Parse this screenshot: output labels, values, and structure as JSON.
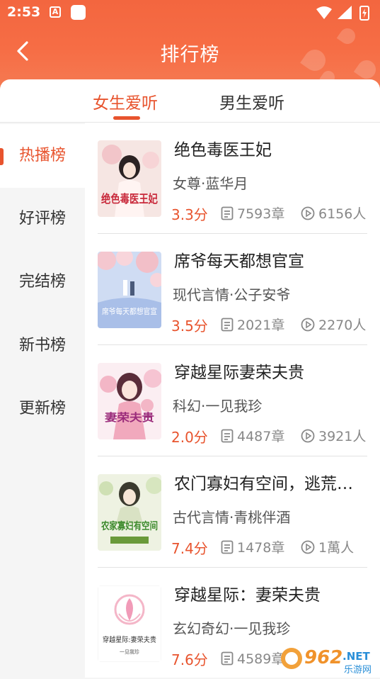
{
  "status_bar": {
    "time": "2:53",
    "a_icon_letter": "A"
  },
  "header": {
    "title": "排行榜",
    "accent_color": "#f3663f"
  },
  "tabs": [
    {
      "label": "女生爱听",
      "active": true
    },
    {
      "label": "男生爱听",
      "active": false
    }
  ],
  "sidebar": {
    "items": [
      {
        "label": "热播榜",
        "active": true
      },
      {
        "label": "好评榜",
        "active": false
      },
      {
        "label": "完结榜",
        "active": false
      },
      {
        "label": "新书榜",
        "active": false
      },
      {
        "label": "更新榜",
        "active": false
      }
    ]
  },
  "books": [
    {
      "title": "绝色毒医王妃",
      "author": "女尊·蓝华月",
      "score": "3.3分",
      "chapters": "7593章",
      "listeners": "6156人",
      "cover_text": "绝色毒医王妃"
    },
    {
      "title": "席爷每天都想官宣",
      "author": "现代言情·公子安爷",
      "score": "3.5分",
      "chapters": "2021章",
      "listeners": "2270人",
      "cover_text": "席爷每天都想官宣"
    },
    {
      "title": "穿越星际妻荣夫贵",
      "author": "科幻·一见我珍",
      "score": "2.0分",
      "chapters": "4487章",
      "listeners": "3921人",
      "cover_text": "妻荣夫贵"
    },
    {
      "title": "农门寡妇有空间，逃荒…",
      "author": "古代言情·青桃伴酒",
      "score": "7.4分",
      "chapters": "1478章",
      "listeners": "1萬人",
      "cover_text": "农家寡妇有空间"
    },
    {
      "title": "穿越星际：妻荣夫贵",
      "author": "玄幻奇幻·一见我珍",
      "score": "7.6分",
      "chapters": "4589章",
      "listeners": "",
      "cover_text": "穿越星际:妻荣夫贵",
      "cover_subtext": "一见我珍"
    }
  ],
  "watermark": {
    "number": "962",
    "domain": ".NET",
    "subtitle": "乐游网"
  }
}
